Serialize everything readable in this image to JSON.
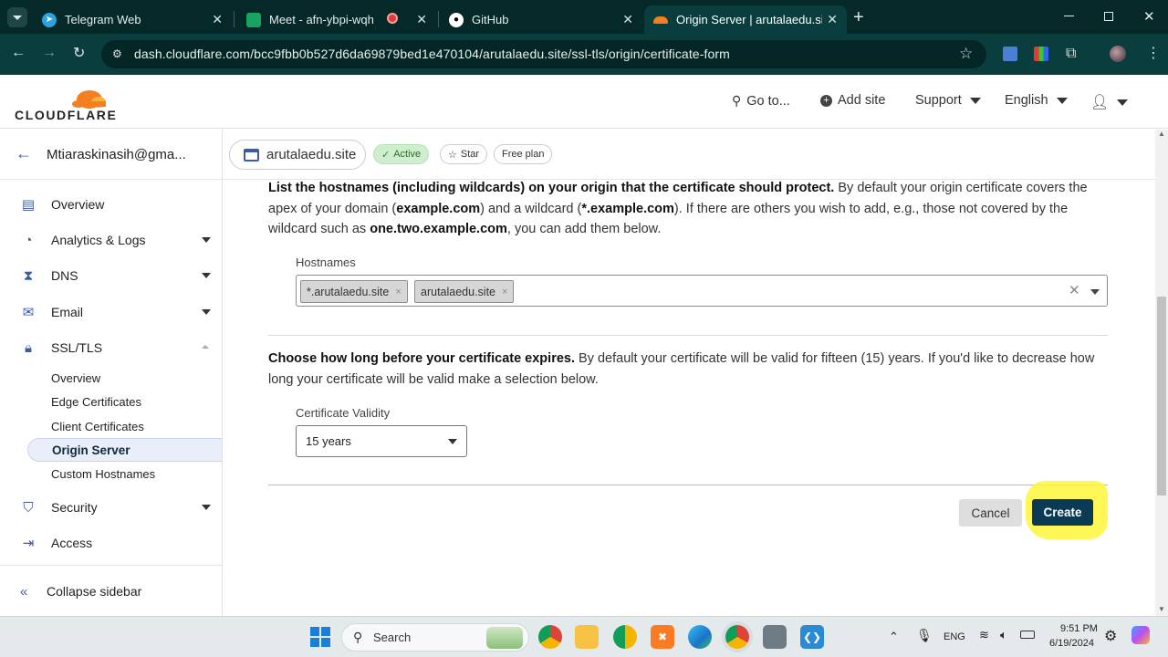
{
  "browser": {
    "tabs": [
      {
        "title": "Telegram Web",
        "favicon": "telegram-icon"
      },
      {
        "title": "Meet - afn-ybpi-wqh",
        "favicon": "meet-icon"
      },
      {
        "title": "",
        "favicon": "record-icon"
      },
      {
        "title": "GitHub",
        "favicon": "github-icon"
      },
      {
        "title": "Origin Server | arutalaedu.site |",
        "favicon": "cloudflare-icon"
      }
    ],
    "url": "dash.cloudflare.com/bcc9fbb0b527d6da69879bed1e470104/arutalaedu.site/ssl-tls/origin/certificate-form"
  },
  "header": {
    "logo": "CLOUDFLARE",
    "goto": "Go to...",
    "add_site": "Add site",
    "support": "Support",
    "language": "English"
  },
  "sidebar": {
    "account": "Mtiaraskinasih@gma...",
    "items": [
      {
        "label": "Overview",
        "icon": "document-icon"
      },
      {
        "label": "Analytics & Logs",
        "icon": "clock-chart-icon"
      },
      {
        "label": "DNS",
        "icon": "network-icon"
      },
      {
        "label": "Email",
        "icon": "mail-icon"
      },
      {
        "label": "SSL/TLS",
        "icon": "lock-icon"
      }
    ],
    "ssl_sub": [
      "Overview",
      "Edge Certificates",
      "Client Certificates",
      "Origin Server",
      "Custom Hostnames"
    ],
    "more": [
      {
        "label": "Security",
        "icon": "shield-icon"
      },
      {
        "label": "Access",
        "icon": "access-icon"
      }
    ],
    "collapse": "Collapse sidebar"
  },
  "site_bar": {
    "domain": "arutalaedu.site",
    "status": "Active",
    "star": "Star",
    "plan": "Free plan"
  },
  "form": {
    "hostnames_p1": "List the hostnames (including wildcards) on your origin that the certificate should protect.",
    "hostnames_p2": " By default your origin certificate covers the apex of your domain (",
    "hostnames_b1": "example.com",
    "hostnames_p3": ") and a wildcard (",
    "hostnames_b2": "*.example.com",
    "hostnames_p4": "). If there are others you wish to add, e.g., those not covered by the wildcard such as ",
    "hostnames_b3": "one.two.example.com",
    "hostnames_p5": ", you can add them below.",
    "hostnames_label": "Hostnames",
    "hostnames": [
      "*.arutalaedu.site",
      "arutalaedu.site"
    ],
    "expiry_bold": "Choose how long before your certificate expires.",
    "expiry_text": " By default your certificate will be valid for fifteen (15) years. If you'd like to decrease how long your certificate will be valid make a selection below.",
    "validity_label": "Certificate Validity",
    "validity_value": "15 years",
    "cancel": "Cancel",
    "create": "Create"
  },
  "taskbar": {
    "search": "Search",
    "lang": "ENG",
    "time": "9:51 PM",
    "date": "6/19/2024"
  },
  "colors": {
    "browser_frame": "#0a3d3d",
    "cf_orange": "#f38020",
    "create_button": "#0b3a54",
    "highlight": "#fff63a",
    "active_badge": "#cfeecd"
  }
}
